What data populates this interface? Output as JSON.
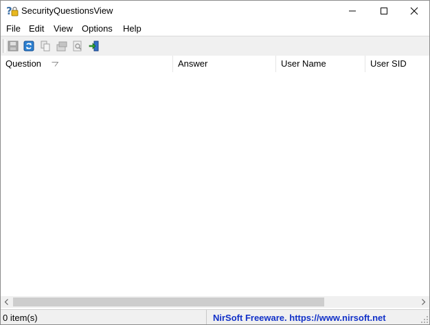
{
  "window": {
    "title": "SecurityQuestionsView",
    "app_icon": "question-lock-icon",
    "controls": [
      "minimize-icon",
      "maximize-icon",
      "close-icon"
    ]
  },
  "menu": {
    "items": [
      "File",
      "Edit",
      "View",
      "Options",
      "Help"
    ]
  },
  "toolbar": {
    "buttons": [
      {
        "icon": "save-icon",
        "enabled": false
      },
      {
        "icon": "refresh-icon",
        "enabled": true
      },
      {
        "icon": "copy-icon",
        "enabled": false
      },
      {
        "icon": "properties-icon",
        "enabled": false
      },
      {
        "icon": "find-icon",
        "enabled": false
      },
      {
        "icon": "exit-icon",
        "enabled": true
      }
    ]
  },
  "table": {
    "columns": [
      "Question",
      "Answer",
      "User Name",
      "User SID"
    ],
    "sorted_column": "Question",
    "rows": []
  },
  "statusbar": {
    "count": "0 item(s)",
    "link": "NirSoft Freeware. https://www.nirsoft.net"
  },
  "colors": {
    "link": "#1030c8",
    "chrome": "#f0f0f0",
    "scroll_thumb": "#cdcdcd"
  }
}
